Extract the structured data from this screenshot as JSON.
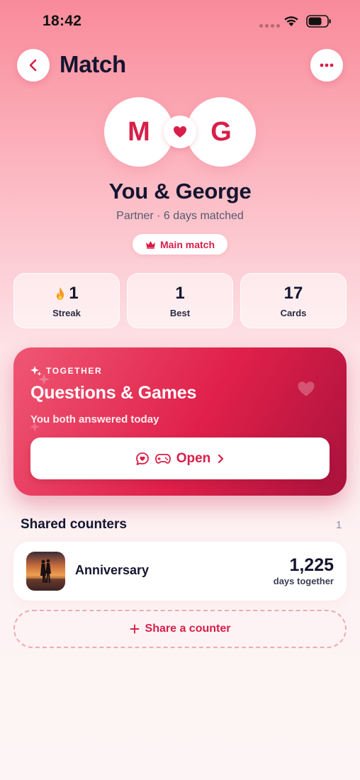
{
  "status_bar": {
    "time": "18:42"
  },
  "header": {
    "title": "Match"
  },
  "match": {
    "avatar_left": "M",
    "avatar_right": "G",
    "names": "You & George",
    "subtitle": "Partner · 6 days matched",
    "badge": "Main match"
  },
  "stats": [
    {
      "value": "1",
      "label": "Streak",
      "icon": "fire-icon"
    },
    {
      "value": "1",
      "label": "Best"
    },
    {
      "value": "17",
      "label": "Cards"
    }
  ],
  "together": {
    "kicker": "TOGETHER",
    "title": "Questions & Games",
    "subtitle": "You both answered today",
    "button_label": "Open"
  },
  "shared_counters": {
    "title": "Shared counters",
    "count": "1",
    "items": [
      {
        "name": "Anniversary",
        "value": "1,225",
        "unit": "days together"
      }
    ],
    "share_label": "Share a counter"
  },
  "colors": {
    "accent": "#d81e48",
    "title_text": "#141530",
    "card_gradient_start": "#ef5773",
    "card_gradient_end": "#a8123c"
  }
}
